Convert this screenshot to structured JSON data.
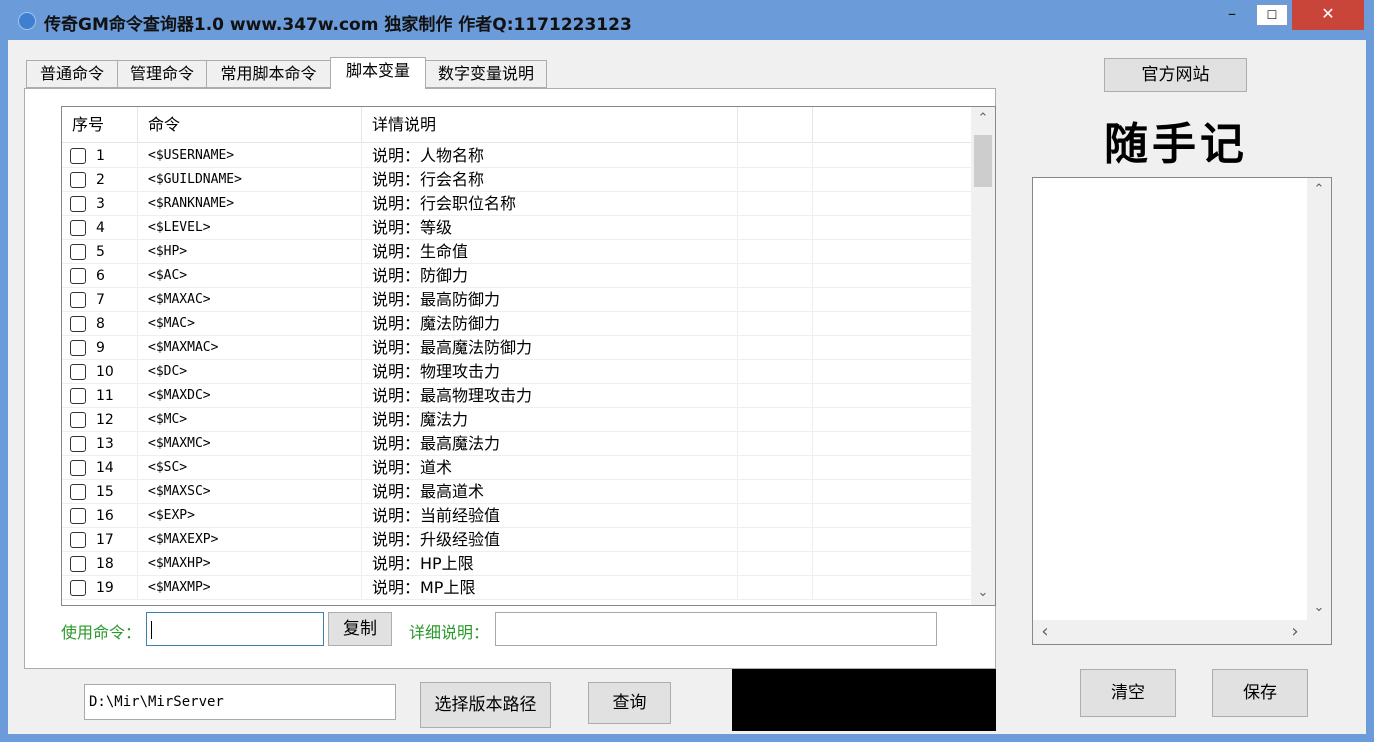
{
  "window": {
    "title": "传奇GM命令查询器1.0 www.347w.com 独家制作 作者Q:1171223123",
    "minimize": "–",
    "maximize": "☐",
    "close": "✕"
  },
  "tabs": [
    {
      "label": "普通命令"
    },
    {
      "label": "管理命令"
    },
    {
      "label": "常用脚本命令"
    },
    {
      "label": "脚本变量",
      "active": true
    },
    {
      "label": "数字变量说明"
    }
  ],
  "table": {
    "columns": [
      "序号",
      "命令",
      "详情说明"
    ],
    "rows": [
      {
        "no": "1",
        "cmd": "<$USERNAME>",
        "desc": "说明：人物名称"
      },
      {
        "no": "2",
        "cmd": "<$GUILDNAME>",
        "desc": "说明：行会名称"
      },
      {
        "no": "3",
        "cmd": "<$RANKNAME>",
        "desc": "说明：行会职位名称"
      },
      {
        "no": "4",
        "cmd": "<$LEVEL>",
        "desc": "说明：等级"
      },
      {
        "no": "5",
        "cmd": "<$HP>",
        "desc": "说明：生命值"
      },
      {
        "no": "6",
        "cmd": "<$AC>",
        "desc": "说明：防御力"
      },
      {
        "no": "7",
        "cmd": "<$MAXAC>",
        "desc": "说明：最高防御力"
      },
      {
        "no": "8",
        "cmd": "<$MAC>",
        "desc": "说明：魔法防御力"
      },
      {
        "no": "9",
        "cmd": "<$MAXMAC>",
        "desc": "说明：最高魔法防御力"
      },
      {
        "no": "10",
        "cmd": "<$DC>",
        "desc": "说明：物理攻击力"
      },
      {
        "no": "11",
        "cmd": "<$MAXDC>",
        "desc": "说明：最高物理攻击力"
      },
      {
        "no": "12",
        "cmd": "<$MC>",
        "desc": "说明：魔法力"
      },
      {
        "no": "13",
        "cmd": "<$MAXMC>",
        "desc": "说明：最高魔法力"
      },
      {
        "no": "14",
        "cmd": "<$SC>",
        "desc": "说明：道术"
      },
      {
        "no": "15",
        "cmd": "<$MAXSC>",
        "desc": "说明：最高道术"
      },
      {
        "no": "16",
        "cmd": "<$EXP>",
        "desc": "说明：当前经验值"
      },
      {
        "no": "17",
        "cmd": "<$MAXEXP>",
        "desc": "说明：升级经验值"
      },
      {
        "no": "18",
        "cmd": "<$MAXHP>",
        "desc": "说明：HP上限"
      },
      {
        "no": "19",
        "cmd": "<$MAXMP>",
        "desc": "说明：MP上限"
      }
    ],
    "scroll_up": "⌃",
    "scroll_down": "⌄"
  },
  "command_bar": {
    "use_label": "使用命令：",
    "use_value": "",
    "copy_button": "复制",
    "detail_label": "详细说明：",
    "detail_value": ""
  },
  "bottom": {
    "path_value": "D:\\Mir\\MirServer",
    "select_path_button": "选择版本路径",
    "query_button": "查询"
  },
  "right": {
    "website_button": "官方网站",
    "title": "随手记",
    "memo_value": "",
    "clear_button": "清空",
    "save_button": "保存",
    "scroll_up": "⌃",
    "scroll_down": "⌄",
    "scroll_left": "‹",
    "scroll_right": "›"
  }
}
